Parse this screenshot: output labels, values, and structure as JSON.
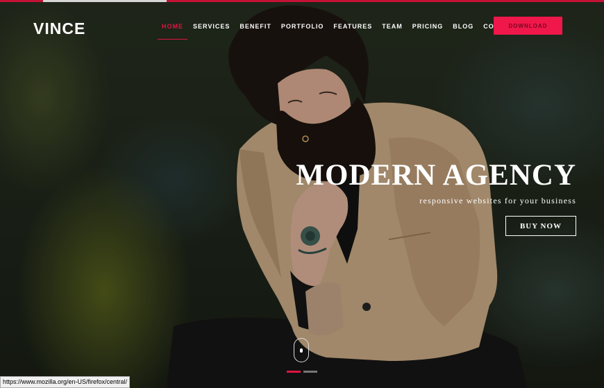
{
  "brand": {
    "logo": "VINCE"
  },
  "nav": {
    "items": [
      "HOME",
      "SERVICES",
      "BENEFIT",
      "PORTFOLIO",
      "FEATURES",
      "TEAM",
      "PRICING",
      "BLOG",
      "CONTACT"
    ],
    "active": "HOME",
    "download_label": "DOWNLOAD"
  },
  "hero": {
    "title": "MODERN AGENCY",
    "subtitle": "responsive websites for your business",
    "cta_label": "BUY NOW"
  },
  "slider": {
    "slide_count": 2,
    "active_index": 0
  },
  "status_bar": {
    "url": "https://www.mozilla.org/en-US/firefox/central/"
  },
  "colors": {
    "accent": "#e0153f",
    "button_bg": "#f0174b",
    "text": "#ffffff"
  }
}
